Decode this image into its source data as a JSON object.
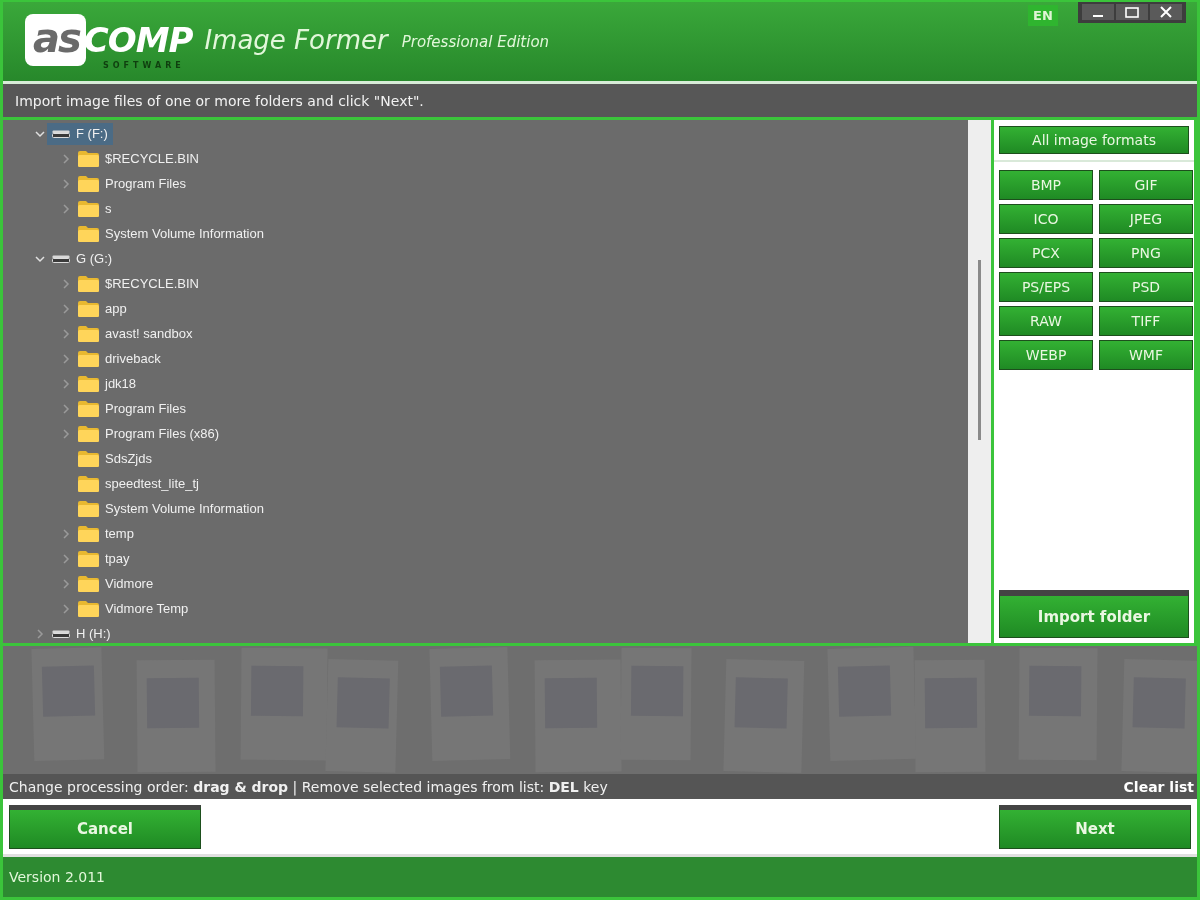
{
  "header": {
    "logo": {
      "mark": "as",
      "word": "COMP",
      "tagline": "SOFTWARE"
    },
    "title": "Image Former",
    "edition": "Professional Edition",
    "language": "EN"
  },
  "instruction": "Import image files of one or more folders and click \"Next\".",
  "tree": [
    {
      "label": "F (F:)",
      "kind": "drive",
      "expanded": true,
      "selected": true,
      "children": [
        {
          "label": "$RECYCLE.BIN",
          "kind": "folder",
          "expanded": false,
          "selected": false,
          "has_children": true
        },
        {
          "label": "Program Files",
          "kind": "folder",
          "expanded": false,
          "selected": false,
          "has_children": true
        },
        {
          "label": "s",
          "kind": "folder",
          "expanded": false,
          "selected": false,
          "has_children": true
        },
        {
          "label": "System Volume Information",
          "kind": "folder",
          "expanded": false,
          "selected": false,
          "has_children": false
        }
      ]
    },
    {
      "label": "G (G:)",
      "kind": "drive",
      "expanded": true,
      "selected": false,
      "children": [
        {
          "label": "$RECYCLE.BIN",
          "kind": "folder",
          "expanded": false,
          "selected": false,
          "has_children": true
        },
        {
          "label": "app",
          "kind": "folder",
          "expanded": false,
          "selected": false,
          "has_children": true
        },
        {
          "label": "avast! sandbox",
          "kind": "folder",
          "expanded": false,
          "selected": false,
          "has_children": true
        },
        {
          "label": "driveback",
          "kind": "folder",
          "expanded": false,
          "selected": false,
          "has_children": true
        },
        {
          "label": "jdk18",
          "kind": "folder",
          "expanded": false,
          "selected": false,
          "has_children": true
        },
        {
          "label": "Program Files",
          "kind": "folder",
          "expanded": false,
          "selected": false,
          "has_children": true
        },
        {
          "label": "Program Files (x86)",
          "kind": "folder",
          "expanded": false,
          "selected": false,
          "has_children": true
        },
        {
          "label": "SdsZjds",
          "kind": "folder",
          "expanded": false,
          "selected": false,
          "has_children": false
        },
        {
          "label": "speedtest_lite_tj",
          "kind": "folder",
          "expanded": false,
          "selected": false,
          "has_children": false
        },
        {
          "label": "System Volume Information",
          "kind": "folder",
          "expanded": false,
          "selected": false,
          "has_children": false
        },
        {
          "label": "temp",
          "kind": "folder",
          "expanded": false,
          "selected": false,
          "has_children": true
        },
        {
          "label": "tpay",
          "kind": "folder",
          "expanded": false,
          "selected": false,
          "has_children": true
        },
        {
          "label": "Vidmore",
          "kind": "folder",
          "expanded": false,
          "selected": false,
          "has_children": true
        },
        {
          "label": "Vidmore Temp",
          "kind": "folder",
          "expanded": false,
          "selected": false,
          "has_children": true
        }
      ]
    },
    {
      "label": "H (H:)",
      "kind": "drive",
      "expanded": false,
      "selected": false,
      "has_children": true
    }
  ],
  "formats": {
    "all_button": "All image formats",
    "buttons": [
      "BMP",
      "GIF",
      "ICO",
      "JPEG",
      "PCX",
      "PNG",
      "PS/EPS",
      "PSD",
      "RAW",
      "TIFF",
      "WEBP",
      "WMF"
    ],
    "import_button": "Import folder"
  },
  "hint": "Change processing order: **drag & drop** | Remove selected images from list: **DEL** key",
  "clear_link": "Clear list",
  "buttons": {
    "cancel": "Cancel",
    "next": "Next"
  },
  "status_bar": "Version 2.011"
}
